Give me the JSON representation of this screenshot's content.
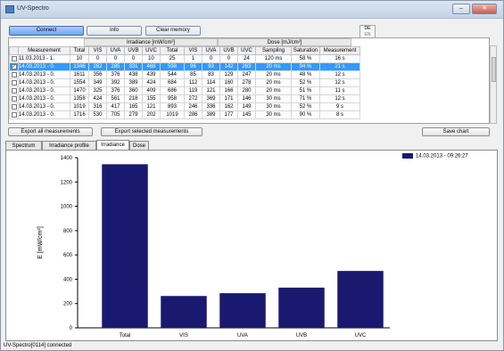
{
  "window": {
    "title": "UV-Spectro",
    "min_icon": "minimize-icon",
    "close_icon": "close-icon"
  },
  "toolbar": {
    "connect": "Connect",
    "info": "Info",
    "clear": "Clear memory"
  },
  "language": {
    "de": "DE",
    "en": "EN"
  },
  "table": {
    "group_irradiance": "Irradiance [mW/cm²]",
    "group_dose": "Dose [mJ/cm²]",
    "columns": [
      "Measurement",
      "Total",
      "VIS",
      "UVA",
      "UVB",
      "UVC",
      "Total",
      "VIS",
      "UVA",
      "UVB",
      "UVC",
      "Sampling",
      "Saturation",
      "Measurement"
    ],
    "rows": [
      {
        "checked": false,
        "cells": [
          "11.03.2013 - 1.",
          "10",
          "0",
          "0",
          "0",
          "10",
          "25",
          "1",
          "0",
          "0",
          "24",
          "120 ms",
          "58 %",
          "16 s"
        ]
      },
      {
        "checked": true,
        "selected": true,
        "cells": [
          "14.03.2013 - 0.",
          "1346",
          "262",
          "285",
          "331",
          "468",
          "598",
          "96",
          "93",
          "142",
          "263",
          "20 ms",
          "94 %",
          "21 s"
        ]
      },
      {
        "checked": false,
        "cells": [
          "14.03.2013 - 0.",
          "1611",
          "356",
          "376",
          "438",
          "439",
          "544",
          "85",
          "83",
          "129",
          "247",
          "20 ms",
          "48 %",
          "12 s"
        ]
      },
      {
        "checked": false,
        "cells": [
          "14.03.2013 - 0.",
          "1554",
          "349",
          "392",
          "389",
          "424",
          "684",
          "112",
          "114",
          "160",
          "278",
          "20 ms",
          "52 %",
          "12 s"
        ]
      },
      {
        "checked": false,
        "cells": [
          "14.03.2013 - 0.",
          "1470",
          "325",
          "376",
          "360",
          "409",
          "686",
          "119",
          "121",
          "166",
          "280",
          "20 ms",
          "51 %",
          "11 s"
        ]
      },
      {
        "checked": false,
        "cells": [
          "14.03.2013 - 0.",
          "1358",
          "424",
          "561",
          "218",
          "155",
          "958",
          "272",
          "369",
          "171",
          "146",
          "30 ms",
          "71 %",
          "12 s"
        ]
      },
      {
        "checked": false,
        "cells": [
          "14.03.2013 - 0.",
          "1019",
          "316",
          "417",
          "165",
          "121",
          "893",
          "246",
          "336",
          "162",
          "149",
          "30 ms",
          "52 %",
          "9 s"
        ]
      },
      {
        "checked": false,
        "cells": [
          "14.03.2013 - 0.",
          "1716",
          "530",
          "705",
          "279",
          "202",
          "1019",
          "286",
          "389",
          "177",
          "145",
          "30 ms",
          "90 %",
          "8 s"
        ]
      }
    ]
  },
  "buttons": {
    "export_all": "Export all measurements",
    "export_selected": "Export selected measurements",
    "save_chart": "Save chart"
  },
  "tabs": [
    "Spectrum",
    "Irradiance profile",
    "Irradiance",
    "Dose"
  ],
  "active_tab": 2,
  "status": "UV-Spectro[0114] connected",
  "chart_data": {
    "type": "bar",
    "categories": [
      "Total",
      "VIS",
      "UVA",
      "UVB",
      "UVC"
    ],
    "series": [
      {
        "name": "14.03.2013 - 09:26:27",
        "values": [
          1346,
          262,
          285,
          331,
          468
        ]
      }
    ],
    "ylabel": "E [mW/cm²]",
    "ylim": [
      0,
      1400
    ],
    "yticks": [
      0,
      200,
      400,
      600,
      800,
      1000,
      1200,
      1400
    ],
    "color": "#191970",
    "grid": false,
    "legend": "top-right"
  }
}
